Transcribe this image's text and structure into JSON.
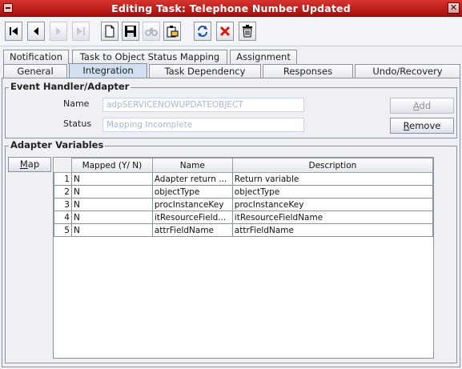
{
  "window": {
    "title": "Editing Task: Telephone Number Updated"
  },
  "toolbar": {
    "buttons": [
      {
        "icon": "first-record-icon",
        "enabled": true
      },
      {
        "icon": "previous-record-icon",
        "enabled": true
      },
      {
        "icon": "next-record-icon",
        "enabled": false
      },
      {
        "icon": "last-record-icon",
        "enabled": false
      },
      {
        "icon": "new-document-icon",
        "enabled": true
      },
      {
        "icon": "save-icon",
        "enabled": true
      },
      {
        "icon": "binoculars-search-icon",
        "enabled": false
      },
      {
        "icon": "clipboard-icon",
        "enabled": true
      },
      {
        "icon": "refresh-icon",
        "enabled": true
      },
      {
        "icon": "delete-x-icon",
        "enabled": true
      },
      {
        "icon": "trash-icon",
        "enabled": true
      }
    ]
  },
  "tabs": {
    "row1": [
      "Notification",
      "Task to Object Status Mapping",
      "Assignment"
    ],
    "row2": [
      "General",
      "Integration",
      "Task Dependency",
      "Responses",
      "Undo/Recovery"
    ],
    "active": "Integration"
  },
  "event_handler": {
    "legend": "Event Handler/Adapter",
    "name_label": "Name",
    "name_value": "adpSERVICENOWUPDATEOBJECT",
    "status_label": "Status",
    "status_value": "Mapping Incomplete",
    "add_label": "Add",
    "remove_label": "Remove"
  },
  "adapter_variables": {
    "legend": "Adapter Variables",
    "map_label": "Map",
    "columns": [
      "Mapped (Y/ N)",
      "Name",
      "Description"
    ],
    "rows": [
      {
        "n": "1",
        "mapped": "N",
        "name": "Adapter return ...",
        "description": "Return variable"
      },
      {
        "n": "2",
        "mapped": "N",
        "name": "objectType",
        "description": "objectType"
      },
      {
        "n": "3",
        "mapped": "N",
        "name": "procInstanceKey",
        "description": "procInstanceKey"
      },
      {
        "n": "4",
        "mapped": "N",
        "name": "itResourceField...",
        "description": "itResourceFieldName"
      },
      {
        "n": "5",
        "mapped": "N",
        "name": "attrFieldName",
        "description": "attrFieldName"
      }
    ]
  },
  "colors": {
    "titlebar": "#b8201c",
    "active_tab": "#d3def0",
    "panel_bg": "#eef0f4"
  }
}
